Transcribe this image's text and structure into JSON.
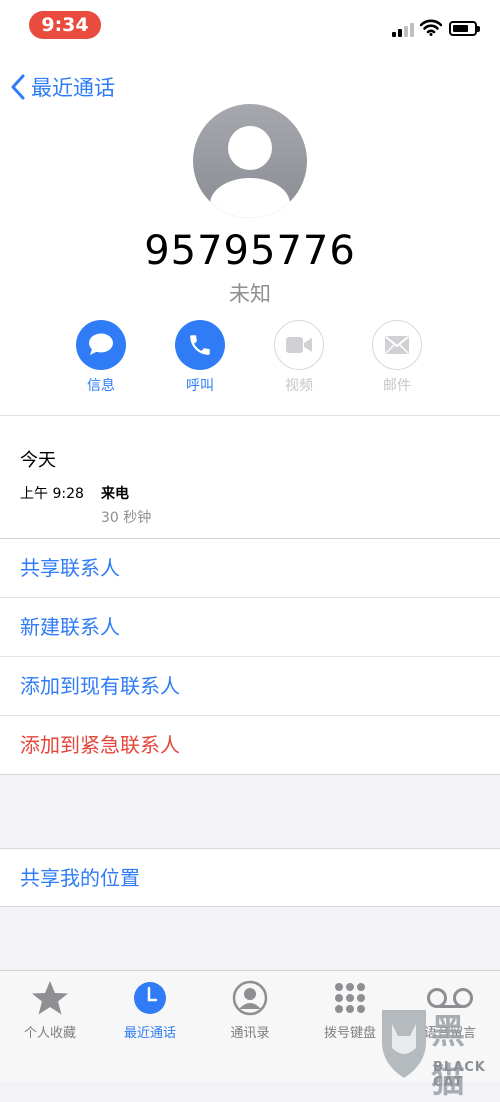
{
  "status": {
    "time": "9:34"
  },
  "nav": {
    "back_label": "最近通话"
  },
  "contact": {
    "number": "95795776",
    "label": "未知"
  },
  "actions": [
    {
      "label": "信息",
      "icon": "message-icon",
      "enabled": true
    },
    {
      "label": "呼叫",
      "icon": "phone-icon",
      "enabled": true
    },
    {
      "label": "视频",
      "icon": "video-icon",
      "enabled": false
    },
    {
      "label": "邮件",
      "icon": "mail-icon",
      "enabled": false
    }
  ],
  "recent": {
    "day": "今天",
    "time": "上午 9:28",
    "type": "来电",
    "duration": "30 秒钟"
  },
  "options": [
    {
      "label": "共享联系人"
    },
    {
      "label": "新建联系人"
    },
    {
      "label": "添加到现有联系人"
    },
    {
      "label": "添加到紧急联系人"
    }
  ],
  "location": {
    "label": "共享我的位置"
  },
  "tabs": [
    {
      "label": "个人收藏",
      "icon": "star-icon"
    },
    {
      "label": "最近通话",
      "icon": "clock-icon",
      "selected": true
    },
    {
      "label": "通讯录",
      "icon": "contacts-icon"
    },
    {
      "label": "拨号键盘",
      "icon": "keypad-icon"
    },
    {
      "label": "语音留言",
      "icon": "voicemail-icon"
    }
  ],
  "watermark": {
    "text": "黑猫",
    "sub": "BLACK CAT"
  },
  "colors": {
    "accent": "#2f7cf6",
    "danger": "#e5463a",
    "time_pill": "#ea4b3f"
  }
}
